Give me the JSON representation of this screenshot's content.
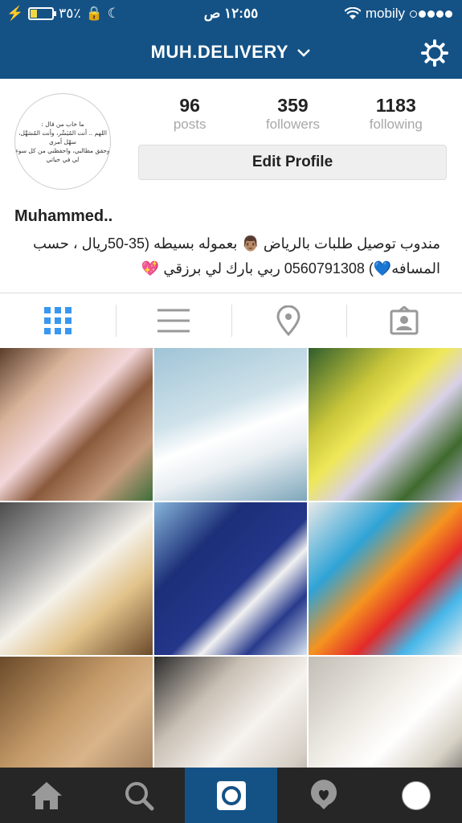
{
  "status_bar": {
    "battery_text": "٣٥٪",
    "time": "١٢:٥٥ ص",
    "carrier": "mobily",
    "signal_bars_filled": 4
  },
  "header": {
    "title": "MUH.DELIVERY"
  },
  "profile": {
    "avatar_text_lines": [
      "ما خاب من قال :",
      "اللهم .. أنت المُيَسِّر، وأنت المُسَهِّل، سهّل أمري",
      "وحقق مطالبي، واحفظني من كل سوء لي في حياتي"
    ],
    "stats": [
      {
        "value": "96",
        "label": "posts"
      },
      {
        "value": "359",
        "label": "followers"
      },
      {
        "value": "1183",
        "label": "following"
      }
    ],
    "edit_button": "Edit Profile",
    "name": "Muhammed..",
    "bio_line1": "مندوب توصيل طلبات بالرياض 👨🏽 بعموله بسيطه (35-50ريال ، حسب",
    "bio_line2": "المسافه💙) 0560791308  ربي بارك لي برزقي 💖"
  },
  "view_tabs": [
    "grid-view",
    "list-view",
    "location-view",
    "tagged-view"
  ],
  "colors": {
    "brand_blue": "#145286",
    "active_tab": "#3897f0",
    "tabbar_dark": "#262626"
  },
  "bottom_tabs": [
    "home",
    "search",
    "camera",
    "activity",
    "profile"
  ]
}
